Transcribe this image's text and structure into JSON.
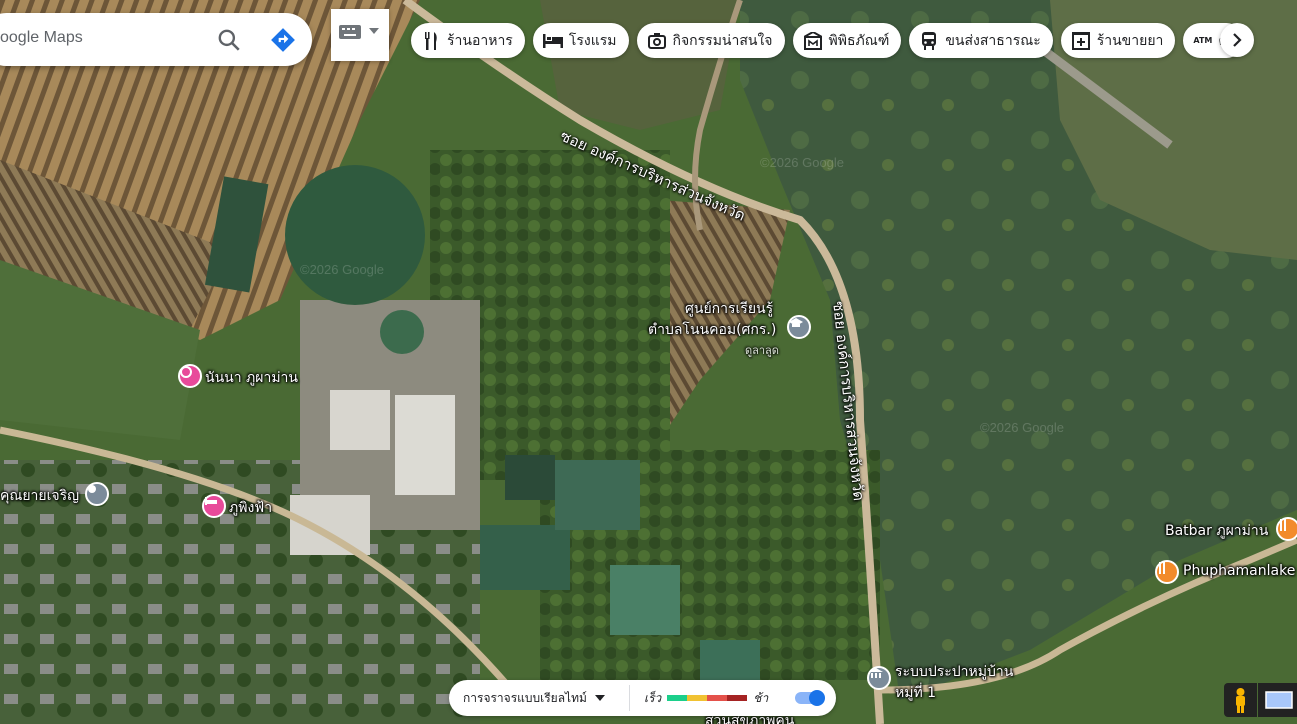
{
  "search": {
    "placeholder": "oogle Maps"
  },
  "chips": [
    {
      "label": "ร้านอาหาร",
      "icon": "fork-knife-icon"
    },
    {
      "label": "โรงแรม",
      "icon": "bed-icon"
    },
    {
      "label": "กิจกรรมน่าสนใจ",
      "icon": "camera-icon"
    },
    {
      "label": "พิพิธภัณฑ์",
      "icon": "museum-icon"
    },
    {
      "label": "ขนส่งสาธารณะ",
      "icon": "train-icon"
    },
    {
      "label": "ร้านขายยา",
      "icon": "pharmacy-icon"
    },
    {
      "label": "ตู้เ",
      "icon": "atm-icon",
      "prefix": "ATM"
    }
  ],
  "roads": [
    {
      "name": "ซอย องค์การบริหารส่วนจังหวัด"
    },
    {
      "name": "ซอย องค์การบริหารส่วนจังหวัด"
    }
  ],
  "places": {
    "learning_center_line1": "ศูนย์การเรียนรู้",
    "learning_center_line2": "ตำบลโนนคอม(ศกร.)",
    "learning_center_sub": "ดูลาลูด",
    "nanna": "นันนา ภูผาม่าน",
    "phuphingfa": "ภูพิงฟ้า",
    "khunyai": "คุณยายเจริญ",
    "batbar": "Batbar ภูผาม่าน",
    "phuphaman_lake": "Phuphamanlake",
    "water_supply_1": "ระบบประปาหมู่บ้าน",
    "water_supply_2": "หมู่ที่ 1",
    "bottom_partial": "ส่วนสุขภาพคน"
  },
  "watermarks": [
    "©2026 Google",
    "©2026 Google",
    "©2026 Google"
  ],
  "traffic": {
    "label": "การจราจรแบบเรียลไทม์",
    "fast": "เร็ว",
    "slow": "ช้า",
    "colors": [
      "#1ccf8b",
      "#f1c232",
      "#e4514a",
      "#a52323"
    ]
  },
  "colors": {
    "pin_pink": "#e84a9a",
    "pin_orange": "#f28b2b",
    "pin_gray": "#7b8b9a"
  }
}
